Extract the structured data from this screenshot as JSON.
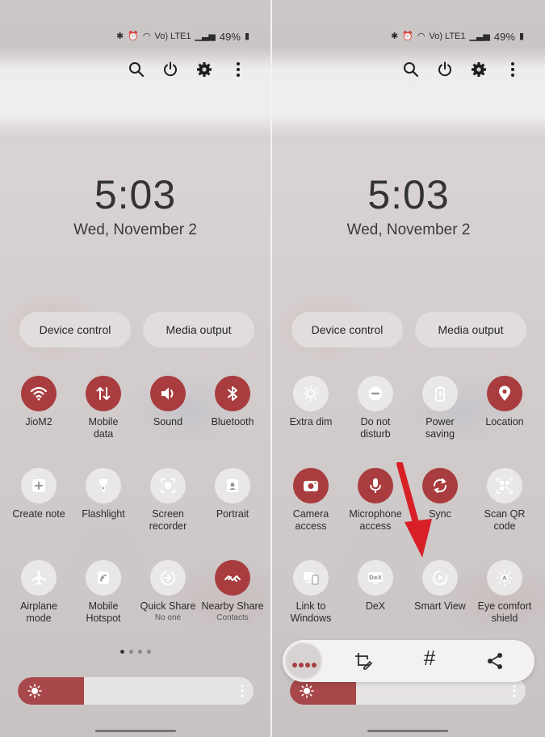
{
  "status": {
    "battery": "49%",
    "network_label": "Vo) LTE1"
  },
  "lockscreen": {
    "time": "5:03",
    "date": "Wed, November 2"
  },
  "buttons": {
    "device_control": "Device control",
    "media_output": "Media output"
  },
  "left_tiles": [
    {
      "label": "JioM2",
      "sub": "",
      "on": true,
      "icon": "wifi-icon"
    },
    {
      "label": "Mobile\ndata",
      "sub": "",
      "on": true,
      "icon": "mobile-data-icon"
    },
    {
      "label": "Sound",
      "sub": "",
      "on": true,
      "icon": "sound-icon"
    },
    {
      "label": "Bluetooth",
      "sub": "",
      "on": true,
      "icon": "bluetooth-icon"
    },
    {
      "label": "Create note",
      "sub": "",
      "on": false,
      "icon": "create-note-icon"
    },
    {
      "label": "Flashlight",
      "sub": "",
      "on": false,
      "icon": "flashlight-icon"
    },
    {
      "label": "Screen\nrecorder",
      "sub": "",
      "on": false,
      "icon": "screen-recorder-icon"
    },
    {
      "label": "Portrait",
      "sub": "",
      "on": false,
      "icon": "portrait-icon"
    },
    {
      "label": "Airplane\nmode",
      "sub": "",
      "on": false,
      "icon": "airplane-icon"
    },
    {
      "label": "Mobile\nHotspot",
      "sub": "",
      "on": false,
      "icon": "hotspot-icon"
    },
    {
      "label": "Quick Share",
      "sub": "No one",
      "on": false,
      "icon": "quick-share-icon"
    },
    {
      "label": "Nearby Share",
      "sub": "Contacts",
      "on": true,
      "icon": "nearby-share-icon"
    }
  ],
  "right_tiles": [
    {
      "label": "Extra dim",
      "sub": "",
      "on": false,
      "icon": "extra-dim-icon"
    },
    {
      "label": "Do not\ndisturb",
      "sub": "",
      "on": false,
      "icon": "do-not-disturb-icon"
    },
    {
      "label": "Power\nsaving",
      "sub": "",
      "on": false,
      "icon": "power-saving-icon"
    },
    {
      "label": "Location",
      "sub": "",
      "on": true,
      "icon": "location-icon"
    },
    {
      "label": "Camera\naccess",
      "sub": "",
      "on": true,
      "icon": "camera-icon"
    },
    {
      "label": "Microphone\naccess",
      "sub": "",
      "on": true,
      "icon": "microphone-icon"
    },
    {
      "label": "Sync",
      "sub": "",
      "on": true,
      "icon": "sync-icon"
    },
    {
      "label": "Scan QR\ncode",
      "sub": "",
      "on": false,
      "icon": "qr-icon"
    },
    {
      "label": "Link to\nWindows",
      "sub": "",
      "on": false,
      "icon": "link-windows-icon"
    },
    {
      "label": "DeX",
      "sub": "",
      "on": false,
      "icon": "dex-icon"
    },
    {
      "label": "Smart View",
      "sub": "",
      "on": false,
      "icon": "smart-view-icon"
    },
    {
      "label": "Eye comfort\nshield",
      "sub": "",
      "on": false,
      "icon": "eye-comfort-icon"
    }
  ],
  "brightness": {
    "level": 0.28
  },
  "page_indicator": {
    "count": 4,
    "current": 0
  },
  "colors": {
    "accent": "#a83c3e",
    "arrow": "#d81f26"
  }
}
